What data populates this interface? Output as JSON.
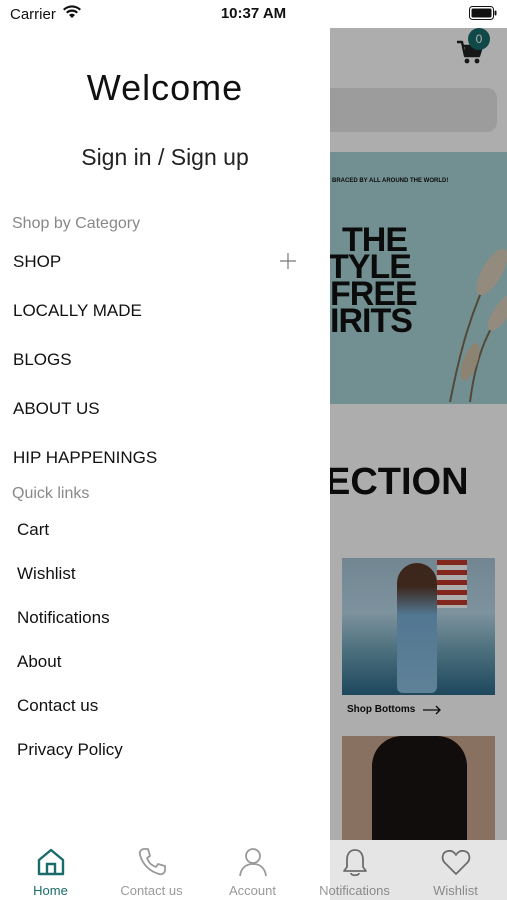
{
  "status_bar": {
    "carrier": "Carrier",
    "time": "10:37 AM"
  },
  "header": {
    "cart_count": "0"
  },
  "banner": {
    "tagline": "BRACED BY ALL AROUND THE WORLD!",
    "lines": [
      "THE",
      "TYLE",
      "FREE",
      "IRITS"
    ]
  },
  "collection_heading": "ECTION",
  "product_caption": "Shop Bottoms",
  "drawer": {
    "welcome": "Welcome",
    "sign_in": "Sign in / Sign up",
    "category_label": "Shop by Category",
    "categories": [
      "SHOP",
      "LOCALLY MADE",
      "BLOGS",
      "ABOUT US",
      "HIP HAPPENINGS"
    ],
    "quick_links_label": "Quick links",
    "quick_links": [
      "Cart",
      "Wishlist",
      "Notifications",
      "About",
      "Contact us",
      "Privacy Policy"
    ]
  },
  "tabs": [
    {
      "label": "Home",
      "icon": "home-icon"
    },
    {
      "label": "Contact us",
      "icon": "phone-icon"
    },
    {
      "label": "Account",
      "icon": "user-icon"
    },
    {
      "label": "Notifications",
      "icon": "bell-icon"
    },
    {
      "label": "Wishlist",
      "icon": "heart-icon"
    }
  ],
  "colors": {
    "accent": "#1a6b6b",
    "inactive": "#9a9a9a",
    "banner_bg": "#a9d4d6"
  }
}
